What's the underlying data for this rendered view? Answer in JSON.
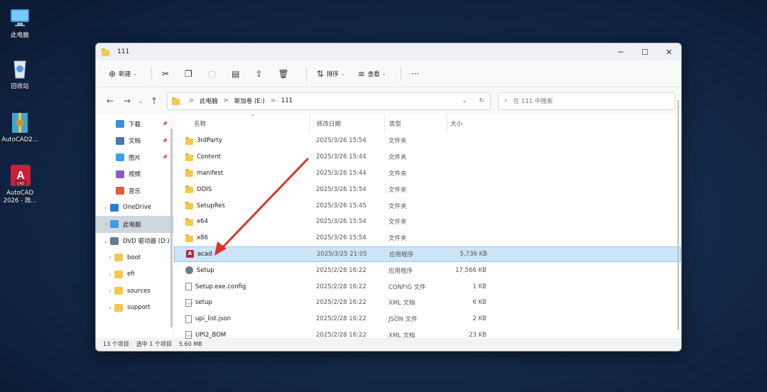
{
  "desktop": {
    "icons": [
      {
        "label": "此电脑",
        "icon": "computer-icon"
      },
      {
        "label": "回收站",
        "icon": "recycle-bin-icon"
      },
      {
        "label": "AutoCAD2...",
        "icon": "archive-icon"
      },
      {
        "label": "AutoCAD 2026 - 简...",
        "icon": "autocad-icon"
      }
    ]
  },
  "window": {
    "title": "111",
    "controls": {
      "minimize": "─",
      "maximize": "☐",
      "close": "✕"
    }
  },
  "toolbar": {
    "new_label": "新建",
    "sort_label": "排序",
    "view_label": "查看",
    "more_label": "···"
  },
  "address": {
    "crumbs": [
      "此电脑",
      "新加卷 (E:)",
      "111"
    ],
    "separator": ">"
  },
  "search": {
    "placeholder": "在 111 中搜索"
  },
  "nav_pane": {
    "items": [
      {
        "label": "下载",
        "pinned": true
      },
      {
        "label": "文档",
        "pinned": true
      },
      {
        "label": "图片",
        "pinned": true
      },
      {
        "label": "视频",
        "pinned": false
      },
      {
        "label": "音乐",
        "pinned": false
      },
      {
        "label": "OneDrive",
        "pinned": false
      },
      {
        "label": "此电脑",
        "pinned": false
      },
      {
        "label": "DVD 驱动器 (D:)",
        "pinned": false
      },
      {
        "label": "boot",
        "pinned": false
      },
      {
        "label": "efi",
        "pinned": false
      },
      {
        "label": "sources",
        "pinned": false
      },
      {
        "label": "support",
        "pinned": false
      }
    ]
  },
  "columns": {
    "name": "名称",
    "date": "修改日期",
    "type": "类型",
    "size": "大小"
  },
  "files": [
    {
      "name": "3rdParty",
      "date": "2025/3/26 15:54",
      "type": "文件夹",
      "size": "",
      "icon": "folder"
    },
    {
      "name": "Content",
      "date": "2025/3/26 15:44",
      "type": "文件夹",
      "size": "",
      "icon": "folder"
    },
    {
      "name": "manifest",
      "date": "2025/3/26 15:44",
      "type": "文件夹",
      "size": "",
      "icon": "folder"
    },
    {
      "name": "ODIS",
      "date": "2025/3/26 15:54",
      "type": "文件夹",
      "size": "",
      "icon": "folder"
    },
    {
      "name": "SetupRes",
      "date": "2025/3/26 15:45",
      "type": "文件夹",
      "size": "",
      "icon": "folder"
    },
    {
      "name": "x64",
      "date": "2025/3/26 15:54",
      "type": "文件夹",
      "size": "",
      "icon": "folder"
    },
    {
      "name": "x86",
      "date": "2025/3/26 15:54",
      "type": "文件夹",
      "size": "",
      "icon": "folder"
    },
    {
      "name": "acad",
      "date": "2025/3/25 21:05",
      "type": "应用程序",
      "size": "5,736 KB",
      "icon": "app-acad"
    },
    {
      "name": "Setup",
      "date": "2025/2/28 16:22",
      "type": "应用程序",
      "size": "17,566 KB",
      "icon": "setup"
    },
    {
      "name": "Setup.exe.config",
      "date": "2025/2/28 16:22",
      "type": "CONFIG 文件",
      "size": "1 KB",
      "icon": "doc"
    },
    {
      "name": "setup",
      "date": "2025/2/28 16:22",
      "type": "XML 文档",
      "size": "6 KB",
      "icon": "xml"
    },
    {
      "name": "upi_list.json",
      "date": "2025/2/28 16:22",
      "type": "JSON 文件",
      "size": "2 KB",
      "icon": "doc"
    },
    {
      "name": "UPI2_BOM",
      "date": "2025/2/28 16:22",
      "type": "XML 文档",
      "size": "23 KB",
      "icon": "xml"
    }
  ],
  "status": {
    "count": "13 个项目",
    "selected": "选中 1 个项目",
    "size": "5.60 MB"
  },
  "colors": {
    "accent": "#d9342b",
    "selection": "#cce4f7"
  }
}
